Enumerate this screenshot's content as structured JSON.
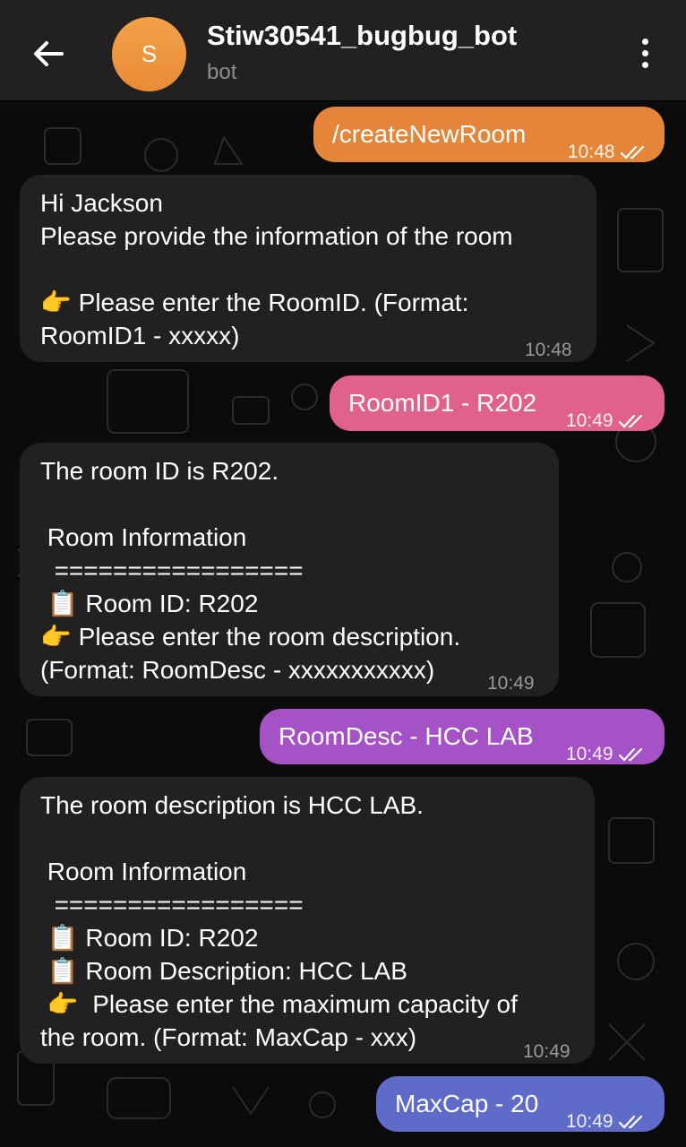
{
  "header": {
    "title": "Stiw30541_bugbug_bot",
    "subtitle": "bot",
    "avatar_letter": "S"
  },
  "colors": {
    "header_bg": "#212121",
    "incoming_bubble": "#212121",
    "avatar": "#f0953f",
    "bubble_orange": "#e4853a",
    "bubble_pink": "#e0628a",
    "bubble_purple": "#a552c7",
    "bubble_blue": "#5e6bc9"
  },
  "messages": [
    {
      "text": "/createNewRoom",
      "time": "10:48"
    },
    {
      "text": "Hi Jackson\nPlease provide the information of the room\n\n👉 Please enter the RoomID. (Format:\nRoomID1 - xxxxx)",
      "time": "10:48"
    },
    {
      "text": "RoomID1 - R202",
      "time": "10:49"
    },
    {
      "text": "The room ID is R202.\n\n Room Information\n  =================\n 📋 Room ID: R202\n👉 Please enter the room description.\n(Format: RoomDesc - xxxxxxxxxxx)",
      "time": "10:49"
    },
    {
      "text": "RoomDesc - HCC LAB",
      "time": "10:49"
    },
    {
      "text": "The room description is HCC LAB.\n\n Room Information\n  =================\n 📋 Room ID: R202\n 📋 Room Description: HCC LAB\n 👉  Please enter the maximum capacity of\nthe room. (Format: MaxCap - xxx)",
      "time": "10:49"
    },
    {
      "text": "MaxCap - 20",
      "time": "10:49"
    }
  ]
}
